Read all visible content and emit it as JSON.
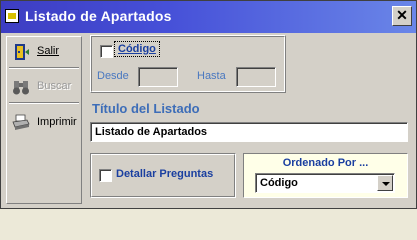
{
  "window": {
    "title": "Listado de Apartados",
    "close_label": "✕"
  },
  "toolbar": {
    "items": [
      {
        "label": "Salir",
        "icon": "exit-door-icon",
        "enabled": true
      },
      {
        "label": "Buscar",
        "icon": "binoculars-icon",
        "enabled": false
      },
      {
        "label": "Imprimir",
        "icon": "printer-icon",
        "enabled": true
      }
    ]
  },
  "filter": {
    "codigo_label": "Código",
    "codigo_checked": false,
    "desde_label": "Desde",
    "desde_value": "",
    "hasta_label": "Hasta",
    "hasta_value": ""
  },
  "listing": {
    "section_title": "Título del Listado",
    "title_value": "Listado de Apartados"
  },
  "options": {
    "detallar_label": "Detallar Preguntas",
    "detallar_checked": false
  },
  "order": {
    "label": "Ordenado Por ...",
    "selected": "Código"
  },
  "colors": {
    "label_blue": "#1a3fa0",
    "section_blue": "#3d6db8",
    "title_bar": "#3d3dc2"
  }
}
